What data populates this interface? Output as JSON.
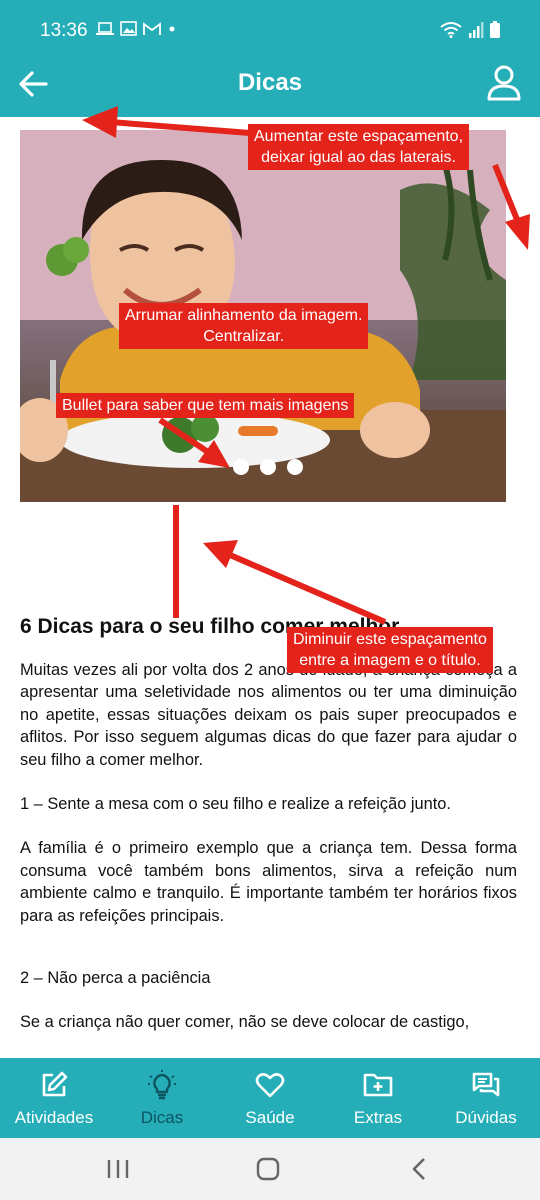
{
  "status": {
    "time": "13:36"
  },
  "header": {
    "title": "Dicas"
  },
  "carousel": {
    "dots": 3
  },
  "article": {
    "title": "6 Dicas para o seu filho comer melhor",
    "paragraphs": [
      "Muitas vezes ali por volta dos 2 anos de idade, a criança começa a apresentar uma seletividade nos alimentos ou ter uma diminuição no apetite, essas situações deixam os pais super preocupados e aflitos. Por isso seguem algumas dicas do que fazer para ajudar o seu filho a comer melhor.",
      "1 – Sente a mesa com o seu filho e realize a refeição junto.",
      "A família é o primeiro exemplo que a criança tem. Dessa forma consuma você também bons alimentos, sirva a refeição num ambiente calmo e tranquilo. É importante também ter horários fixos para as refeições principais.",
      "2 – Não perca a paciência",
      "Se a criança não quer comer, não se deve colocar de castigo,"
    ]
  },
  "annotations": {
    "spacing_top_line1": "Aumentar este espaçamento,",
    "spacing_top_line2": "deixar igual ao das laterais.",
    "align_line1": "Arrumar alinhamento da imagem.",
    "align_line2": "Centralizar.",
    "bullet": "Bullet para saber que tem mais imagens",
    "spacing_title_line1": "Diminuir este espaçamento",
    "spacing_title_line2": "entre a imagem e o título."
  },
  "nav": {
    "items": [
      {
        "label": "Atividades",
        "icon": "edit-icon"
      },
      {
        "label": "Dicas",
        "icon": "lightbulb-icon",
        "active": true
      },
      {
        "label": "Saúde",
        "icon": "heart-icon"
      },
      {
        "label": "Extras",
        "icon": "folder-plus-icon"
      },
      {
        "label": "Dúvidas",
        "icon": "chat-icon"
      }
    ]
  },
  "colors": {
    "primary": "#25aeb8",
    "annotation": "#e4231b",
    "active_nav": "#0d5560"
  }
}
